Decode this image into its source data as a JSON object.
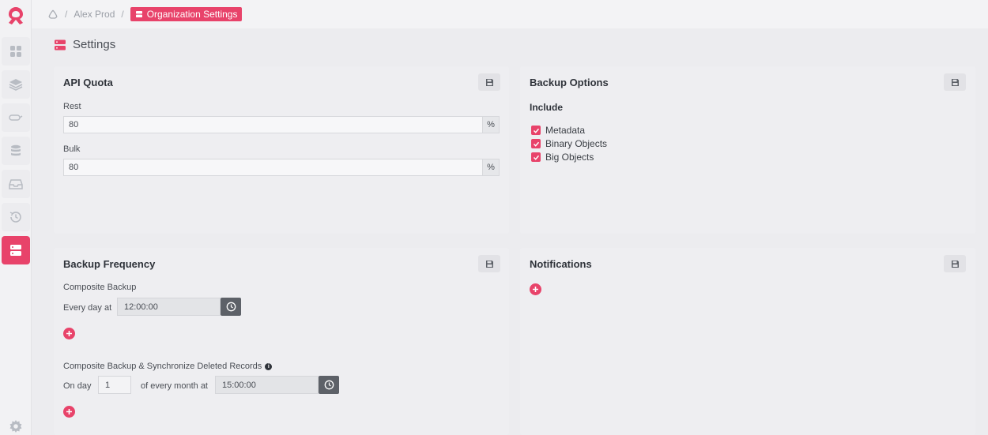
{
  "breadcrumb": {
    "items": [
      "Alex Prod"
    ],
    "active": "Organization Settings",
    "separator": "/"
  },
  "page": {
    "title": "Settings"
  },
  "api_quota": {
    "title": "API Quota",
    "rest_label": "Rest",
    "rest_value": "80",
    "bulk_label": "Bulk",
    "bulk_value": "80",
    "unit": "%"
  },
  "backup_options": {
    "title": "Backup Options",
    "include_label": "Include",
    "options": [
      {
        "label": "Metadata",
        "checked": true
      },
      {
        "label": "Binary Objects",
        "checked": true
      },
      {
        "label": "Big Objects",
        "checked": true
      }
    ]
  },
  "backup_frequency": {
    "title": "Backup Frequency",
    "composite": {
      "label": "Composite Backup",
      "every_day_label": "Every day at",
      "time": "12:00:00"
    },
    "composite_sync": {
      "label": "Composite Backup & Synchronize Deleted Records",
      "on_day_label": "On day",
      "day": "1",
      "month_label": "of every month at",
      "time": "15:00:00"
    }
  },
  "notifications": {
    "title": "Notifications"
  },
  "colors": {
    "accent": "#e8436a",
    "panel": "#eeeef1",
    "background": "#ececef"
  }
}
